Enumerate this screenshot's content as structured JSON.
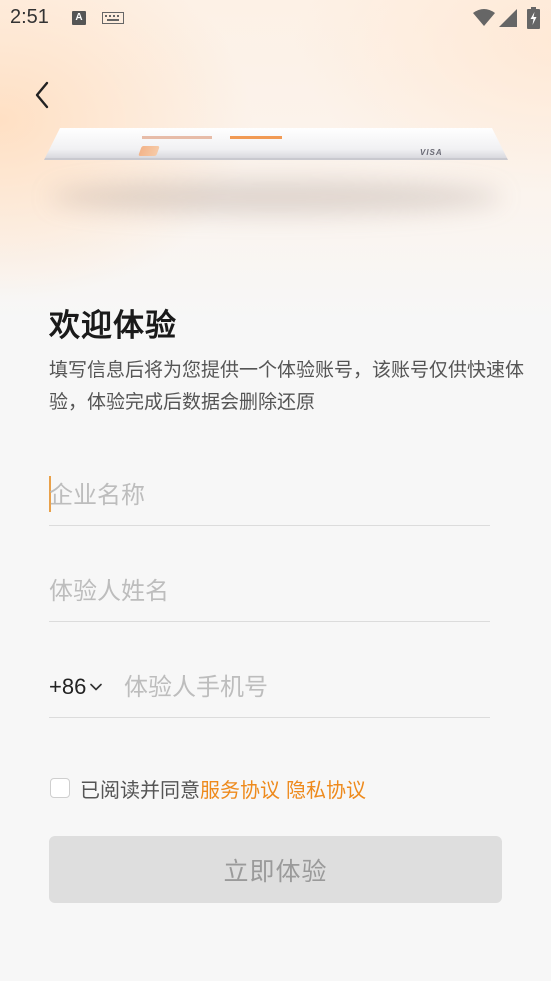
{
  "status_bar": {
    "time": "2:51",
    "notification_icon_letter": "A"
  },
  "header": {
    "back_icon": "chevron-left-icon"
  },
  "card_illustration": {
    "brand": "VISA"
  },
  "welcome": {
    "title": "欢迎体验",
    "subtitle": "填写信息后将为您提供一个体验账号，该账号仅供快速体验，体验完成后数据会删除还原"
  },
  "form": {
    "company_placeholder": "企业名称",
    "name_placeholder": "体验人姓名",
    "country_code": "+86",
    "phone_placeholder": "体验人手机号"
  },
  "agreement": {
    "text": "已阅读并同意",
    "service_link": "服务协议",
    "privacy_link": "隐私协议",
    "checked": false
  },
  "submit": {
    "label": "立即体验"
  },
  "colors": {
    "accent": "#ee8a1c",
    "cursor": "#e9a14a",
    "button_disabled_bg": "#dedede",
    "button_disabled_text": "#9a9a9a"
  }
}
